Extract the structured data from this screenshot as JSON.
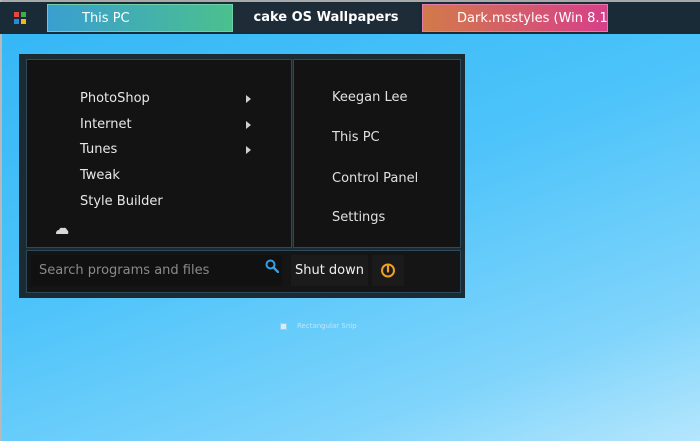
{
  "taskbar": {
    "tasks": [
      {
        "label": "This PC"
      },
      {
        "label": "cake OS Wallpapers"
      },
      {
        "label": "Dark.msstyles (Win 8.1..."
      }
    ],
    "colors": {
      "task1_from": "#3a9fd0",
      "task1_to": "#4bc08e",
      "task3_from": "#d27a4a",
      "task3_to": "#d6408a"
    }
  },
  "start_menu": {
    "programs": [
      {
        "label": "PhotoShop",
        "has_submenu": true
      },
      {
        "label": "Internet",
        "has_submenu": true
      },
      {
        "label": "Tunes",
        "has_submenu": true
      },
      {
        "label": "Tweak",
        "has_submenu": false
      },
      {
        "label": "Style Builder",
        "has_submenu": false
      }
    ],
    "places": [
      {
        "label": "Keegan Lee"
      },
      {
        "label": "This PC"
      },
      {
        "label": "Control Panel"
      },
      {
        "label": "Settings"
      }
    ],
    "search": {
      "placeholder": "Search programs and files"
    },
    "shutdown_label": "Shut down",
    "accent": "#f0a020",
    "icons": [
      "start-logo-icon",
      "submenu-arrow-icon",
      "cloud-icon",
      "search-icon",
      "power-icon"
    ]
  },
  "desktop": {
    "ghost_label": "Rectangular Snip"
  }
}
